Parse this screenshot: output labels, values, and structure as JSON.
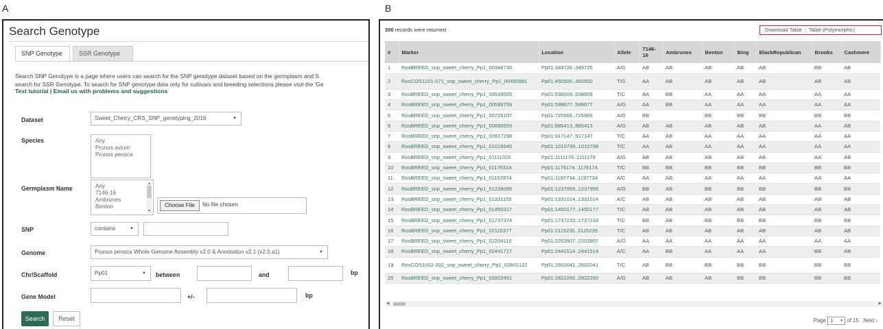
{
  "labels": {
    "a": "A",
    "b": "B"
  },
  "panel_a": {
    "title": "Search Genotype",
    "tabs": [
      "SNP Genotype",
      "SSR Genotype"
    ],
    "description_line1": "Search SNP Genotype is a page where users can search for the SNP genotype dataset based on the germplasm and S",
    "description_line2": "search for SSR Genotype. To search for SNP genotype data only for cultivars and breeding selections please visit the 'Ge",
    "link_tutorial": "Text tutorial",
    "link_separator": " | ",
    "link_email": "Email us with problems and suggestions",
    "dataset": {
      "label": "Dataset",
      "value": "Sweet_Cherry_CRS_SNP_genotyping_2016"
    },
    "species": {
      "label": "Species",
      "options": [
        "Any",
        "Prunus avium",
        "Prunus persica"
      ]
    },
    "germplasm": {
      "label": "Germplasm Name",
      "options": [
        "Any",
        "7146-16",
        "Ambrunes",
        "Benton"
      ],
      "file_button": "Choose File",
      "file_text": "No file chosen"
    },
    "snp": {
      "label": "SNP",
      "operator": "contains",
      "value": ""
    },
    "genome": {
      "label": "Genome",
      "value": "Prunus persica Whole Genome Assembly v2.0 & Annotation v2.1 (v2.0.a1)"
    },
    "chr": {
      "label": "Chr/Scaffold",
      "value": "Pp01",
      "between": "between",
      "and": "and",
      "unit": "bp"
    },
    "gene_model": {
      "label": "Gene Model",
      "plusminus": "+/-",
      "unit": "bp"
    },
    "buttons": {
      "search": "Search",
      "reset": "Reset"
    }
  },
  "panel_b": {
    "records_count": "300",
    "records_text": " records were returned",
    "download_table": "Download Table",
    "download_separator": "|",
    "download_polymorphic": "Table (Polymorphic)",
    "columns": [
      "#",
      "Marker",
      "Location",
      "Allele",
      "7146-16",
      "Ambrunes",
      "Benton",
      "Bing",
      "BlackRepublican",
      "Brooks",
      "Cashmere"
    ],
    "rows": [
      [
        "1",
        "RosBREED_snp_sweet_cherry_Pp1_00348730",
        "Pp01:349726..349726",
        "A/G",
        "AB",
        "AB",
        "AB",
        "AB",
        "AB",
        "BB",
        "AB"
      ],
      [
        "2",
        "RosCOS1201-071_snp_sweet_cherry_Pp1_00450881",
        "Pp01:450500..450500",
        "T/G",
        "AA",
        "AB",
        "AB",
        "AB",
        "AB",
        "AB",
        "AB"
      ],
      [
        "3",
        "RosBREED_snp_sweet_cherry_Pp1_00538005",
        "Pp01:538009..538009",
        "T/C",
        "AA",
        "BB",
        "AA",
        "AA",
        "AA",
        "AA",
        "AA"
      ],
      [
        "4",
        "RosBREED_snp_sweet_cherry_Pp1_00599759",
        "Pp01:599677..599677",
        "A/G",
        "AA",
        "BB",
        "AA",
        "AA",
        "AA",
        "AA",
        "AA"
      ],
      [
        "5",
        "RosBREED_snp_sweet_cherry_Pp1_00726107",
        "Pp01:725966..725966",
        "A/G",
        "BB",
        "",
        "BB",
        "BB",
        "BB",
        "BB",
        "BB"
      ],
      [
        "6",
        "RosBREED_snp_sweet_cherry_Pp1_00885553",
        "Pp01:885413..885413",
        "A/G",
        "AB",
        "AB",
        "AB",
        "AB",
        "AB",
        "AA",
        "AB"
      ],
      [
        "7",
        "RosBREED_snp_sweet_cherry_Pp1_00917298",
        "Pp01:917147..917147",
        "T/C",
        "AA",
        "AB",
        "AA",
        "AA",
        "AA",
        "AA",
        "AA"
      ],
      [
        "8",
        "RosBREED_snp_sweet_cherry_Pp1_01016940",
        "Pp01:1010799..1010799",
        "T/C",
        "AA",
        "AB",
        "AA",
        "AA",
        "AA",
        "AA",
        "AA"
      ],
      [
        "9",
        "RosBREED_snp_sweet_cherry_Pp1_01111320",
        "Pp01:1111179..1111179",
        "A/G",
        "AB",
        "AB",
        "AB",
        "AB",
        "AB",
        "AA",
        "AB"
      ],
      [
        "10",
        "RosBREED_snp_sweet_cherry_Pp1_01176314",
        "Pp01:1176174..1176174",
        "T/C",
        "BB",
        "BB",
        "BB",
        "BB",
        "BB",
        "BB",
        "BB"
      ],
      [
        "11",
        "RosBREED_snp_sweet_cherry_Pp1_01197874",
        "Pp01:1197734..1197734",
        "A/C",
        "AA",
        "AB",
        "AA",
        "AA",
        "AA",
        "AA",
        "AA"
      ],
      [
        "12",
        "RosBREED_snp_sweet_cherry_Pp1_01238095",
        "Pp01:1237955..1237955",
        "A/G",
        "BB",
        "AB",
        "BB",
        "BB",
        "BB",
        "BB",
        "BB"
      ],
      [
        "13",
        "RosBREED_snp_sweet_cherry_Pp1_01331155",
        "Pp01:1331014..1331014",
        "A/C",
        "AB",
        "AB",
        "AB",
        "AB",
        "AB",
        "AB",
        "AB"
      ],
      [
        "14",
        "RosBREED_snp_sweet_cherry_Pp1_01450317",
        "Pp01:1450177..1450177",
        "T/C",
        "AB",
        "AB",
        "AB",
        "AB",
        "AB",
        "AB",
        "AB"
      ],
      [
        "15",
        "RosBREED_snp_sweet_cherry_Pp1_01737374",
        "Pp01:1737233..1737233",
        "T/C",
        "BB",
        "AB",
        "BB",
        "BB",
        "BB",
        "BB",
        "BB"
      ],
      [
        "16",
        "RosBREED_snp_sweet_cherry_Pp1_02115377",
        "Pp01:2115235..2115235",
        "T/C",
        "AB",
        "AB",
        "AB",
        "AB",
        "AB",
        "AB",
        "AB"
      ],
      [
        "17",
        "RosBREED_snp_sweet_cherry_Pp1_02204110",
        "Pp01:2203907..2203907",
        "A/G",
        "AA",
        "AA",
        "AA",
        "AA",
        "AA",
        "AA",
        "AA"
      ],
      [
        "18",
        "RosBREED_snp_sweet_cherry_Pp1_02441717",
        "Pp01:2441514..2441514",
        "A/C",
        "AA",
        "BB",
        "AA",
        "AA",
        "AA",
        "BB",
        "AB"
      ],
      [
        "19",
        "RosCOS1002-202_snp_sweet_cherry_Pp1_02602122",
        "Pp01:2602041..2602041",
        "T/C",
        "AB",
        "BB",
        "BB",
        "BB",
        "BB",
        "BB",
        "BB"
      ],
      [
        "20",
        "RosBREED_snp_sweet_cherry_Pp1_02822451",
        "Pp01:2822260..2822260",
        "A/G",
        "AB",
        "AB",
        "AB",
        "BB",
        "BB",
        "BB",
        "BB"
      ]
    ],
    "pager": {
      "page_label": "Page",
      "page_value": "1",
      "of_text": "of 15",
      "next": "Next ›"
    }
  }
}
